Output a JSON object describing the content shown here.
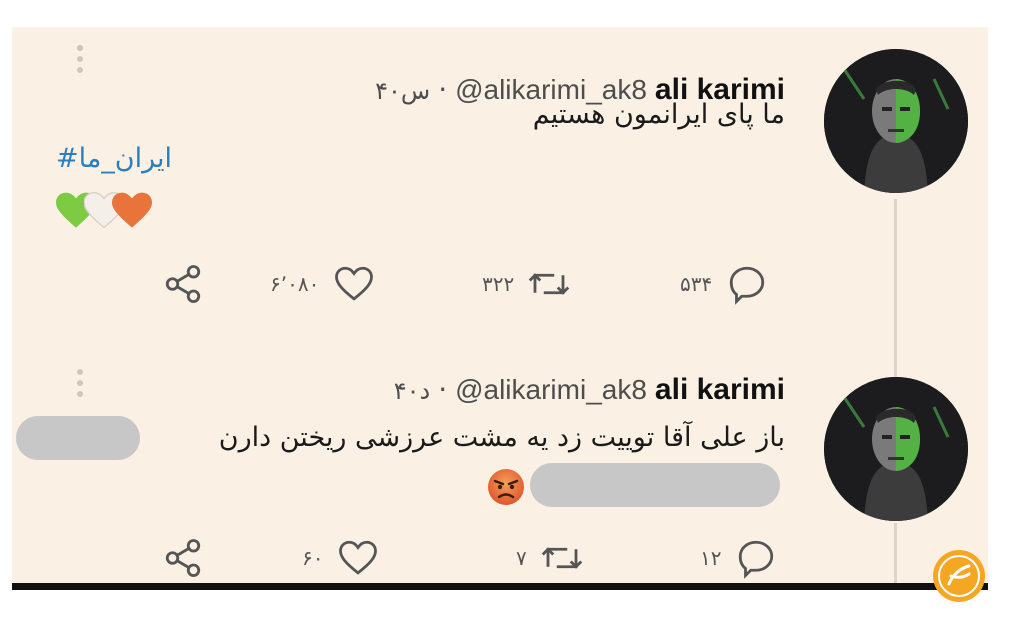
{
  "tweets": [
    {
      "name": "ali karimi",
      "handle": "@alikarimi_ak8",
      "separator": "·",
      "time": "۴۰س",
      "text": "ما پای ایرانمون هستیم",
      "hashtag": "ایران_ما#",
      "hearts": [
        "green-heart",
        "white-heart",
        "orange-heart"
      ],
      "reply_count": "۵۳۴",
      "retweet_count": "۳۲۲",
      "like_count": "۶٬۰۸۰"
    },
    {
      "name": "ali karimi",
      "handle": "@alikarimi_ak8",
      "separator": "·",
      "time": "۴۰د",
      "text_line1": "باز علی آقا توییت زد یه مشت عرزشی ریختن دارن",
      "text_line2": "",
      "emoji": "angry-face",
      "reply_count": "۱۲",
      "retweet_count": "۷",
      "like_count": "۶۰"
    }
  ],
  "icons": [
    "reply-icon",
    "retweet-icon",
    "like-icon",
    "share-icon",
    "more-options-icon"
  ],
  "colors": {
    "background": "#faf1e4",
    "hashtag": "#2a7fc0",
    "icon": "#555555",
    "redaction": "#c7c7c7"
  }
}
